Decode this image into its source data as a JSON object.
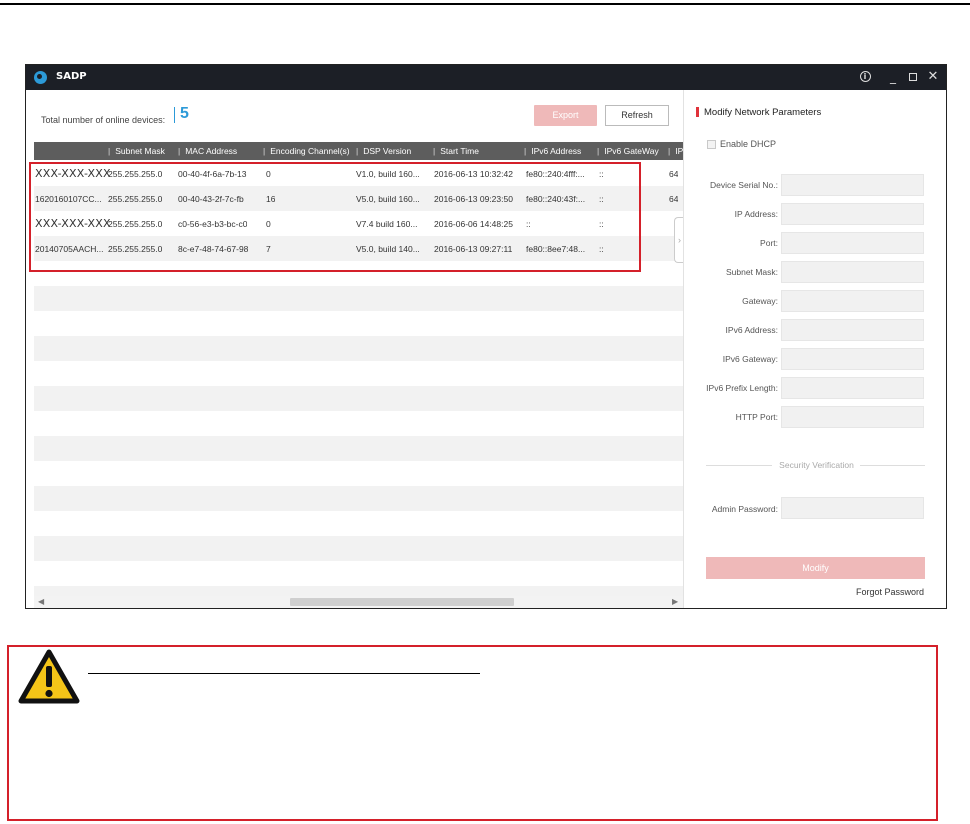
{
  "window": {
    "title": "SADP",
    "info_glyph": "i",
    "minimize_glyph": "_",
    "close_glyph": "✕"
  },
  "device_list": {
    "online_label": "Total number of online devices:",
    "online_count": "5",
    "export_label": "Export",
    "refresh_label": "Refresh",
    "columns": [
      "Subnet Mask",
      "MAC Address",
      "Encoding Channel(s)",
      "DSP Version",
      "Start Time",
      "IPv6 Address",
      "IPv6 GateWay",
      "IP"
    ],
    "rows": [
      {
        "id": "XXX-XXX-XXX",
        "subnet": "255.255.255.0",
        "mac": "00-40-4f-6a-7b-13",
        "channels": "0",
        "dsp": "V1.0, build 160...",
        "start": "2016-06-13 10:32:42",
        "ipv6": "fe80::240:4fff:...",
        "gateway": "::",
        "extra": "64"
      },
      {
        "id": "1620160107CC...",
        "subnet": "255.255.255.0",
        "mac": "00-40-43-2f-7c-fb",
        "channels": "16",
        "dsp": "V5.0, build 160...",
        "start": "2016-06-13 09:23:50",
        "ipv6": "fe80::240:43f:...",
        "gateway": "::",
        "extra": "64"
      },
      {
        "id": "XXX-XXX-XXX",
        "subnet": "255.255.255.0",
        "mac": "c0-56-e3-b3-bc-c0",
        "channels": "0",
        "dsp": "V7.4 build 160...",
        "start": "2016-06-06 14:48:25",
        "ipv6": "::",
        "gateway": "::",
        "extra": ""
      },
      {
        "id": "20140705AACH...",
        "subnet": "255.255.255.0",
        "mac": "8c-e7-48-74-67-98",
        "channels": "7",
        "dsp": "V5.0, build 140...",
        "start": "2016-06-13 09:27:11",
        "ipv6": "fe80::8ee7:48...",
        "gateway": "::",
        "extra": ""
      }
    ],
    "collapse_glyph": "›",
    "scroll_left_glyph": "◀",
    "scroll_right_glyph": "▶"
  },
  "panel": {
    "title": "Modify Network Parameters",
    "dhcp_label": "Enable DHCP",
    "fields": [
      "Device Serial No.:",
      "IP Address:",
      "Port:",
      "Subnet Mask:",
      "Gateway:",
      "IPv6 Address:",
      "IPv6 Gateway:",
      "IPv6 Prefix Length:",
      "HTTP Port:"
    ],
    "security_label": "Security Verification",
    "admin_password_label": "Admin Password:",
    "modify_label": "Modify",
    "forgot_label": "Forgot Password"
  },
  "colors": {
    "accent_blue": "#2c9ad8",
    "highlight_red": "#d4202a",
    "disabled_button": "#efb9b9",
    "warning_yellow": "#f5c518"
  },
  "icons": {
    "warning": "warning-triangle-icon"
  }
}
